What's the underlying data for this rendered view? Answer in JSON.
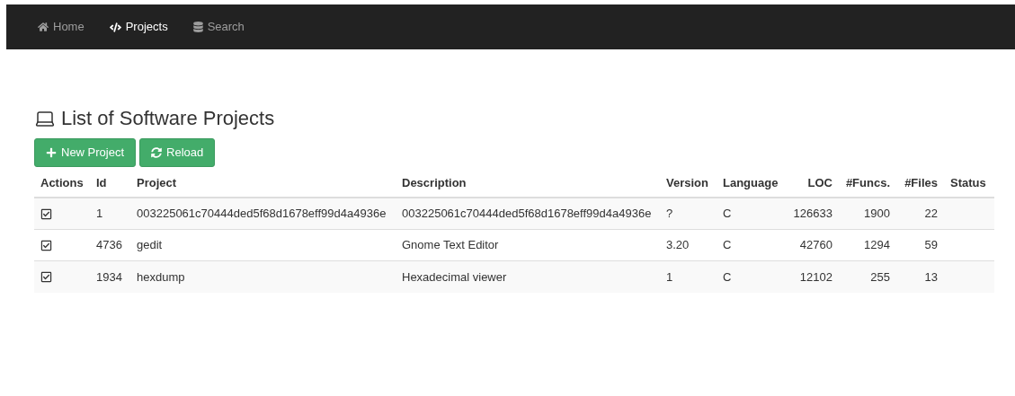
{
  "navbar": {
    "items": [
      {
        "label": "Home",
        "kind": "home",
        "selected": false
      },
      {
        "label": "Projects",
        "kind": "code",
        "selected": true
      },
      {
        "label": "Search",
        "kind": "database",
        "selected": false
      }
    ]
  },
  "page": {
    "title": "List of Software Projects",
    "buttons": [
      {
        "label": "New Project",
        "kind": "plus"
      },
      {
        "label": "Reload",
        "kind": "reload"
      }
    ]
  },
  "table": {
    "columns": [
      {
        "label": "Actions"
      },
      {
        "label": "Id"
      },
      {
        "label": "Project"
      },
      {
        "label": "Description"
      },
      {
        "label": "Version"
      },
      {
        "label": "Language"
      },
      {
        "label": "LOC"
      },
      {
        "label": "#Funcs."
      },
      {
        "label": "#Files"
      },
      {
        "label": "Status"
      }
    ],
    "rows": [
      {
        "id": "1",
        "project": "003225061c70444ded5f68d1678eff99d4a4936e",
        "description": "003225061c70444ded5f68d1678eff99d4a4936e",
        "version": "?",
        "language": "C",
        "loc": "126633",
        "funcs": "1900",
        "files": "22"
      },
      {
        "id": "4736",
        "project": "gedit",
        "description": "Gnome Text Editor",
        "version": "3.20",
        "language": "C",
        "loc": "42760",
        "funcs": "1294",
        "files": "59"
      },
      {
        "id": "1934",
        "project": "hexdump",
        "description": "Hexadecimal viewer",
        "version": "1",
        "language": "C",
        "loc": "12102",
        "funcs": "255",
        "files": "13"
      }
    ]
  }
}
